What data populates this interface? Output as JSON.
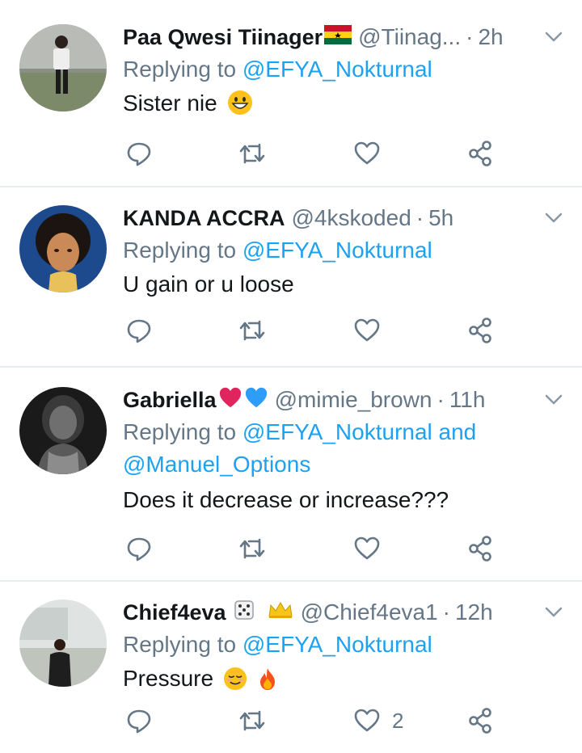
{
  "tweets": [
    {
      "name": "Paa Qwesi Tiinager",
      "handle": "@Tiinag...",
      "separator": "·",
      "time": "2h",
      "replying_prefix": "Replying to ",
      "replying_to": "@EFYA_Nokturnal",
      "text": "Sister nie",
      "like_count": ""
    },
    {
      "name": "KANDA ACCRA",
      "handle": "@4kskoded",
      "separator": "·",
      "time": "5h",
      "replying_prefix": "Replying to ",
      "replying_to": "@EFYA_Nokturnal",
      "text": "U gain or u loose",
      "like_count": ""
    },
    {
      "name": "Gabriella",
      "handle": "@mimie_brown",
      "separator": "·",
      "time": "11h",
      "replying_prefix": "Replying to ",
      "replying_to": "@EFYA_Nokturnal and",
      "replying_to_2": "@Manuel_Options",
      "text": "Does it decrease or increase???",
      "like_count": ""
    },
    {
      "name": "Chief4eva",
      "handle": "@Chief4eva1",
      "separator": "·",
      "time": "12h",
      "replying_prefix": "Replying to ",
      "replying_to": "@EFYA_Nokturnal",
      "text": "Pressure",
      "like_count": "2"
    }
  ],
  "colors": {
    "accent": "#1da1f2",
    "secondary_text": "#657786",
    "primary_text": "#14171a",
    "divider": "#e6ecf0"
  },
  "icons": [
    "reply-icon",
    "retweet-icon",
    "like-icon",
    "share-icon",
    "chevron-down-icon"
  ]
}
